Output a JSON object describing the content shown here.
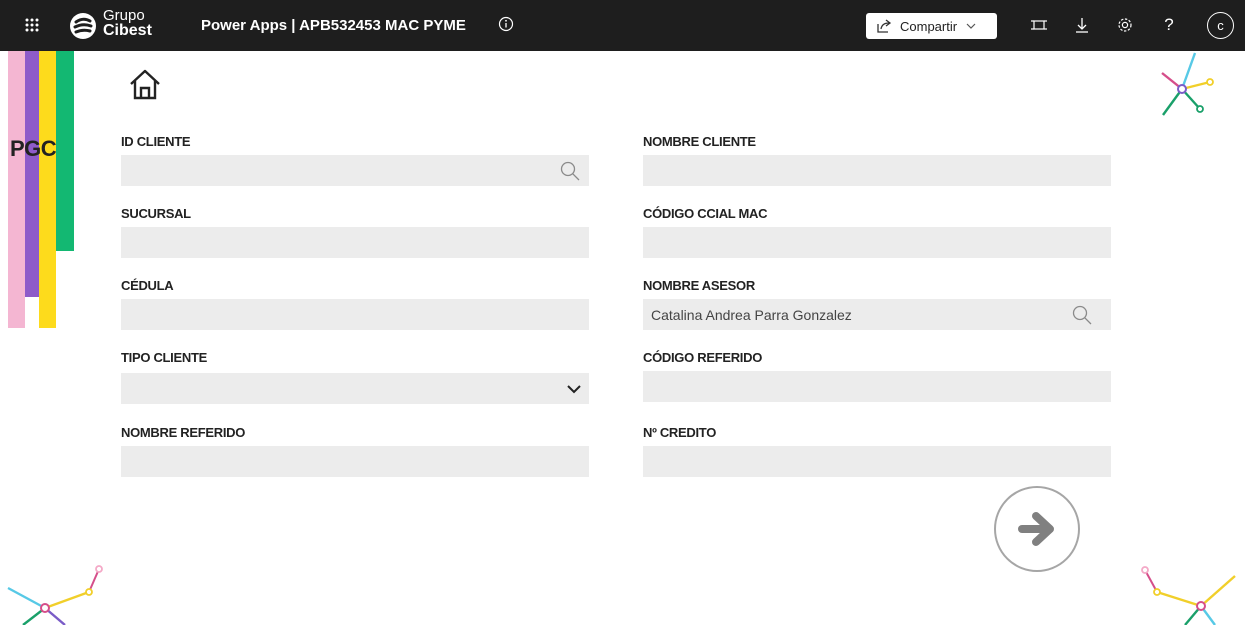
{
  "topbar": {
    "brand_line1": "Grupo",
    "brand_line2": "Cibest",
    "app_title": "Power Apps | APB532453 MAC PYME",
    "share_label": "Compartir",
    "avatar_initial": "c",
    "icons": [
      "app-launcher-icon",
      "info-icon",
      "share-icon",
      "chevron-down-icon",
      "fit-screen-icon",
      "download-icon",
      "settings-icon",
      "help-icon"
    ]
  },
  "side": {
    "label": "PGC",
    "bar_colors": [
      "#f4b6d2",
      "#8e5bc9",
      "#fddb1c",
      "#13b872"
    ]
  },
  "form": {
    "left": [
      {
        "label": "ID CLIENTE",
        "value": "",
        "control": "search"
      },
      {
        "label": "SUCURSAL",
        "value": "",
        "control": "text"
      },
      {
        "label": "CÉDULA",
        "value": "",
        "control": "text"
      },
      {
        "label": "TIPO CLIENTE",
        "value": "",
        "control": "dropdown"
      },
      {
        "label": "NOMBRE REFERIDO",
        "value": "",
        "control": "text"
      }
    ],
    "right": [
      {
        "label": "NOMBRE CLIENTE",
        "value": "",
        "control": "text"
      },
      {
        "label": "CÓDIGO CCIAL MAC",
        "value": "",
        "control": "text"
      },
      {
        "label": "NOMBRE ASESOR",
        "value": "Catalina Andrea Parra Gonzalez",
        "control": "search"
      },
      {
        "label": "CÓDIGO REFERIDO",
        "value": "",
        "control": "text"
      },
      {
        "label": "Nº CREDITO",
        "value": "",
        "control": "text"
      }
    ]
  },
  "colors": {
    "topbar": "#1e1e1e",
    "input_bg": "#ececec",
    "next_arrow": "#808080"
  }
}
